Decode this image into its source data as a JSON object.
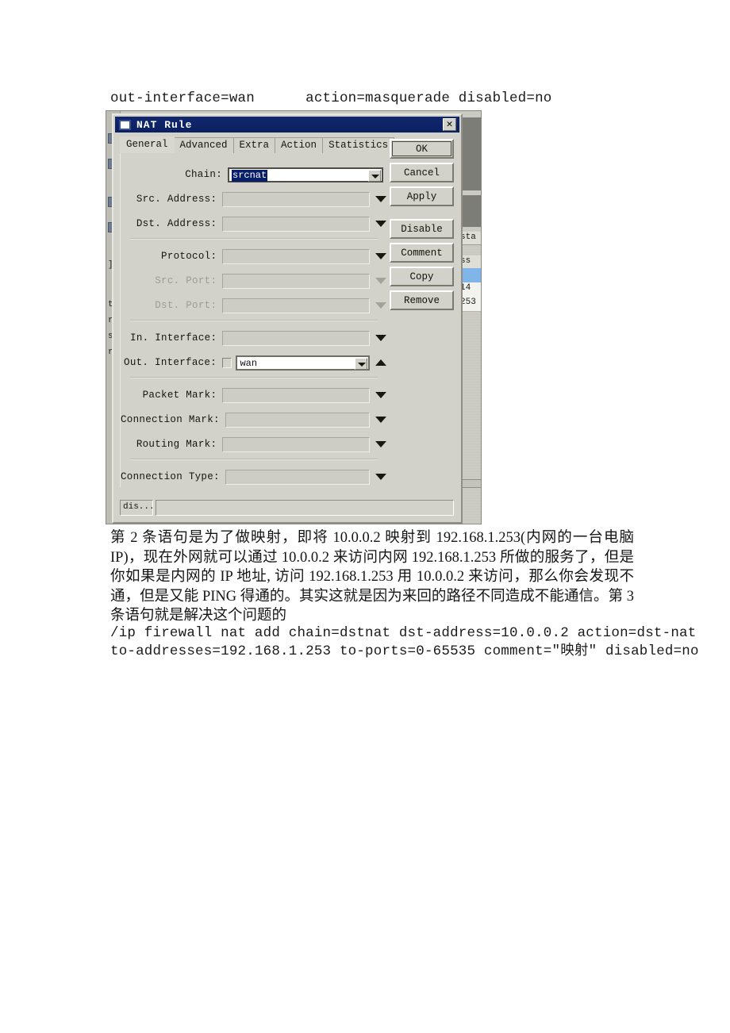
{
  "document": {
    "top_code_line": "out-interface=wan      action=masquerade disabled=no",
    "paragraph": "第 2 条语句是为了做映射，即将 10.0.0.2 映射到 192.168.1.253(内网的一台电脑 IP)，现在外网就可以通过 10.0.0.2 来访问内网 192.168.1.253 所做的服务了，但是你如果是内网的 IP 地址, 访问 192.168.1.253 用 10.0.0.2 来访问，那么你会发现不通，但是又能 PING 得通的。其实这就是因为来回的路径不同造成不能通信。第 3 条语句就是解决这个问题的",
    "bottom_code_line_1": "/ip firewall nat add chain=dstnat dst-address=10.0.0.2 action=dst-nat",
    "bottom_code_line_2": "to-addresses=192.168.1.253 to-ports=0-65535 comment=\"映射\" disabled=no"
  },
  "dialog": {
    "title": "NAT Rule",
    "close_label": "✕",
    "tabs": [
      {
        "label": "General",
        "active": true
      },
      {
        "label": "Advanced",
        "active": false
      },
      {
        "label": "Extra",
        "active": false
      },
      {
        "label": "Action",
        "active": false
      },
      {
        "label": "Statistics",
        "active": false
      }
    ],
    "fields": [
      {
        "label": "Chain:",
        "value": "srcnat",
        "selected": true,
        "disabled": false,
        "style": "active-outline"
      },
      {
        "label": "Src. Address:",
        "value": "",
        "selected": false,
        "disabled": false,
        "style": "flat"
      },
      {
        "label": "Dst. Address:",
        "value": "",
        "selected": false,
        "disabled": false,
        "style": "flat"
      },
      {
        "label": "Protocol:",
        "value": "",
        "selected": false,
        "disabled": false,
        "style": "flat"
      },
      {
        "label": "Src. Port:",
        "value": "",
        "selected": false,
        "disabled": true,
        "style": "flat"
      },
      {
        "label": "Dst. Port:",
        "value": "",
        "selected": false,
        "disabled": true,
        "style": "flat"
      },
      {
        "label": "In. Interface:",
        "value": "",
        "selected": false,
        "disabled": false,
        "style": "flat"
      },
      {
        "label": "Out. Interface:",
        "value": "wan",
        "selected": false,
        "disabled": false,
        "style": "checkbox-white"
      },
      {
        "label": "Packet Mark:",
        "value": "",
        "selected": false,
        "disabled": false,
        "style": "flat"
      },
      {
        "label": "Connection Mark:",
        "value": "",
        "selected": false,
        "disabled": false,
        "style": "flat"
      },
      {
        "label": "Routing Mark:",
        "value": "",
        "selected": false,
        "disabled": false,
        "style": "flat"
      },
      {
        "label": "Connection Type:",
        "value": "",
        "selected": false,
        "disabled": false,
        "style": "flat"
      }
    ],
    "buttons": [
      {
        "label": "OK",
        "default": true
      },
      {
        "label": "Cancel",
        "default": false
      },
      {
        "label": "Apply",
        "default": false
      },
      {
        "label": "Disable",
        "default": false
      },
      {
        "label": "Comment",
        "default": false
      },
      {
        "label": "Copy",
        "default": false
      },
      {
        "label": "Remove",
        "default": false
      }
    ],
    "status": {
      "left_text": "dis...",
      "right_text": ""
    }
  },
  "background_window": {
    "fragments": [
      "]",
      "t",
      "r",
      "s",
      "r"
    ],
    "list": {
      "header_fragment": "sta",
      "column_fragment": "ss",
      "rows": [
        {
          "text": "",
          "selected": true
        },
        {
          "text": "14",
          "selected": false
        },
        {
          "text": "253",
          "selected": false
        }
      ]
    }
  },
  "colors": {
    "titlebar": "#0b2060",
    "dialog_face": "#d2d2ca",
    "selection": "#0a1f69",
    "list_selection": "#7fb5e8",
    "text": "#151515"
  }
}
